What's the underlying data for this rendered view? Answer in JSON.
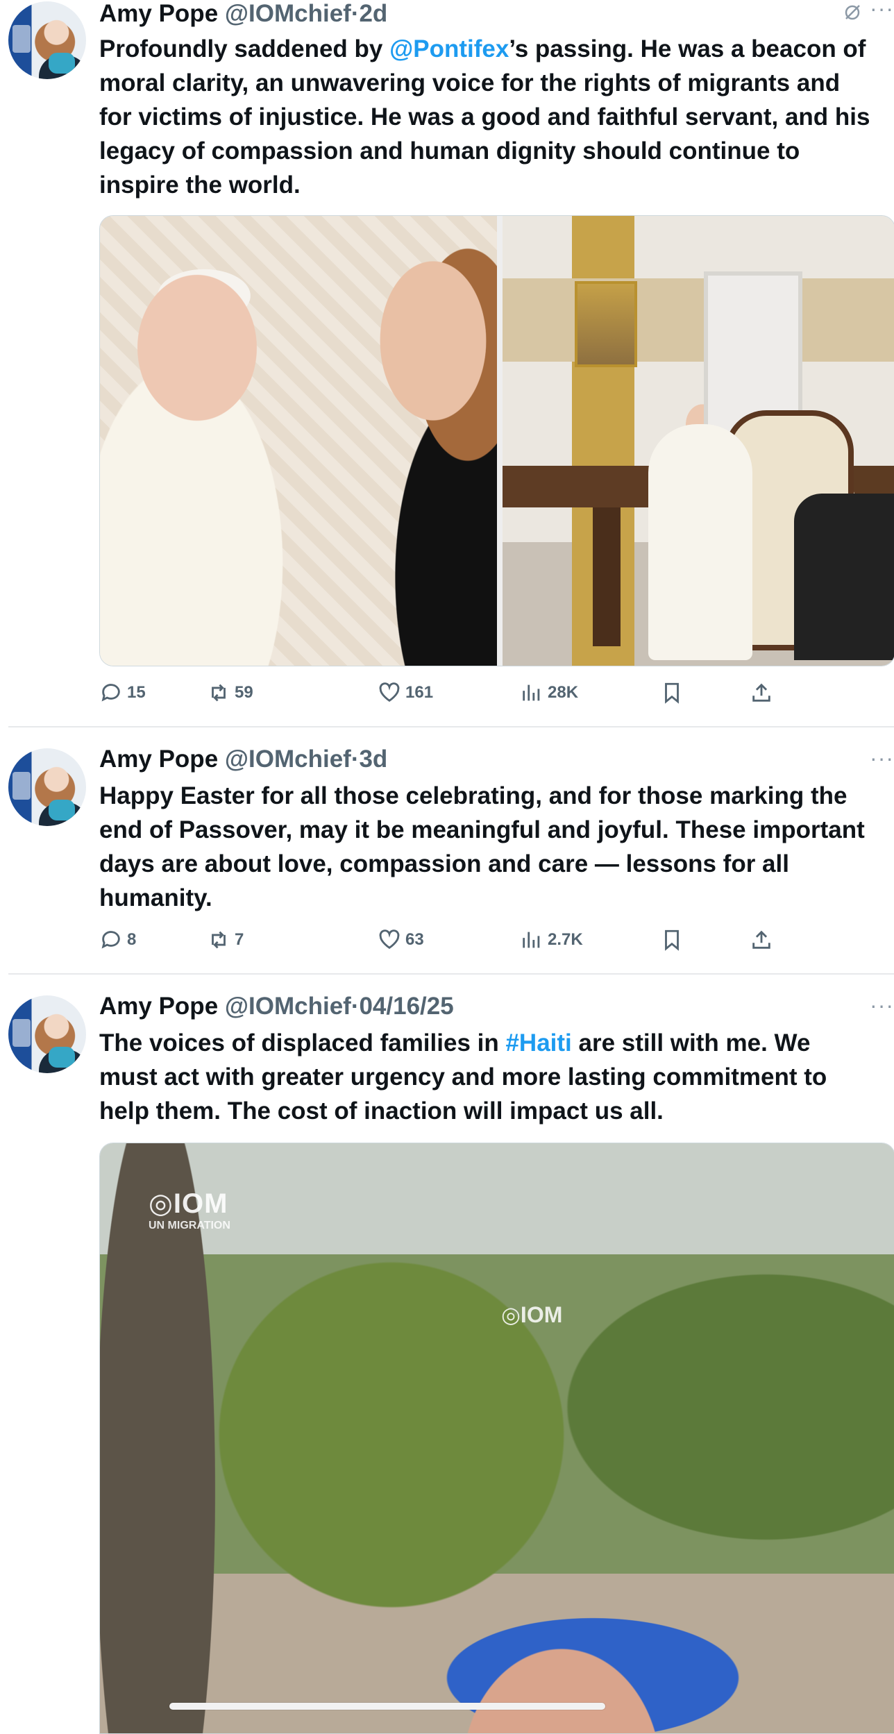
{
  "tweets": [
    {
      "name": "Amy Pope",
      "handle": "@IOMchief",
      "separator": "·",
      "time": "2d",
      "text_lines": [
        {
          "pre": "Profoundly saddened by ",
          "mention": "@Pontifex",
          "post": "’s passing. He was a beacon of"
        },
        {
          "text": "moral clarity, an unwavering voice for the rights of migrants and"
        },
        {
          "text": "for victims of injustice. He was a good and faithful servant, and his"
        },
        {
          "text": "legacy of compassion and human dignity should continue to"
        },
        {
          "text": "inspire the world."
        }
      ],
      "media": {
        "type": "photos",
        "count": 2
      },
      "stats": {
        "replies": "15",
        "reposts": "59",
        "likes": "161",
        "views": "28K"
      },
      "icons": {
        "grok": "grok-icon",
        "more": "more-icon"
      }
    },
    {
      "name": "Amy Pope",
      "handle": "@IOMchief",
      "separator": "·",
      "time": "3d",
      "text_lines": [
        {
          "text": "Happy Easter for all those celebrating, and for those marking the"
        },
        {
          "text": "end of Passover, may it be meaningful and joyful. These important"
        },
        {
          "text": "days are about love, compassion and care — lessons for all"
        },
        {
          "text": "humanity."
        }
      ],
      "stats": {
        "replies": "8",
        "reposts": "7",
        "likes": "63",
        "views": "2.7K"
      },
      "icons": {
        "more": "more-icon"
      }
    },
    {
      "name": "Amy Pope",
      "handle": "@IOMchief",
      "separator": "·",
      "time": "04/16/25",
      "text_lines": [
        {
          "pre": "The voices of displaced families in ",
          "mention": "#Haiti",
          "post": " are still with me. We"
        },
        {
          "text": "must act with greater urgency and more lasting commitment to"
        },
        {
          "text": "help them. The cost of inaction will impact us all."
        }
      ],
      "media": {
        "type": "video",
        "watermark": "IOM",
        "watermark_sub": "UN MIGRATION",
        "cap_logo": "IOM"
      },
      "icons": {
        "more": "more-icon"
      }
    }
  ],
  "more_glyph": "···",
  "colors": {
    "text": "#0f1419",
    "secondary": "#536471",
    "link": "#1d9bf0",
    "divider": "#e7e9eb"
  }
}
